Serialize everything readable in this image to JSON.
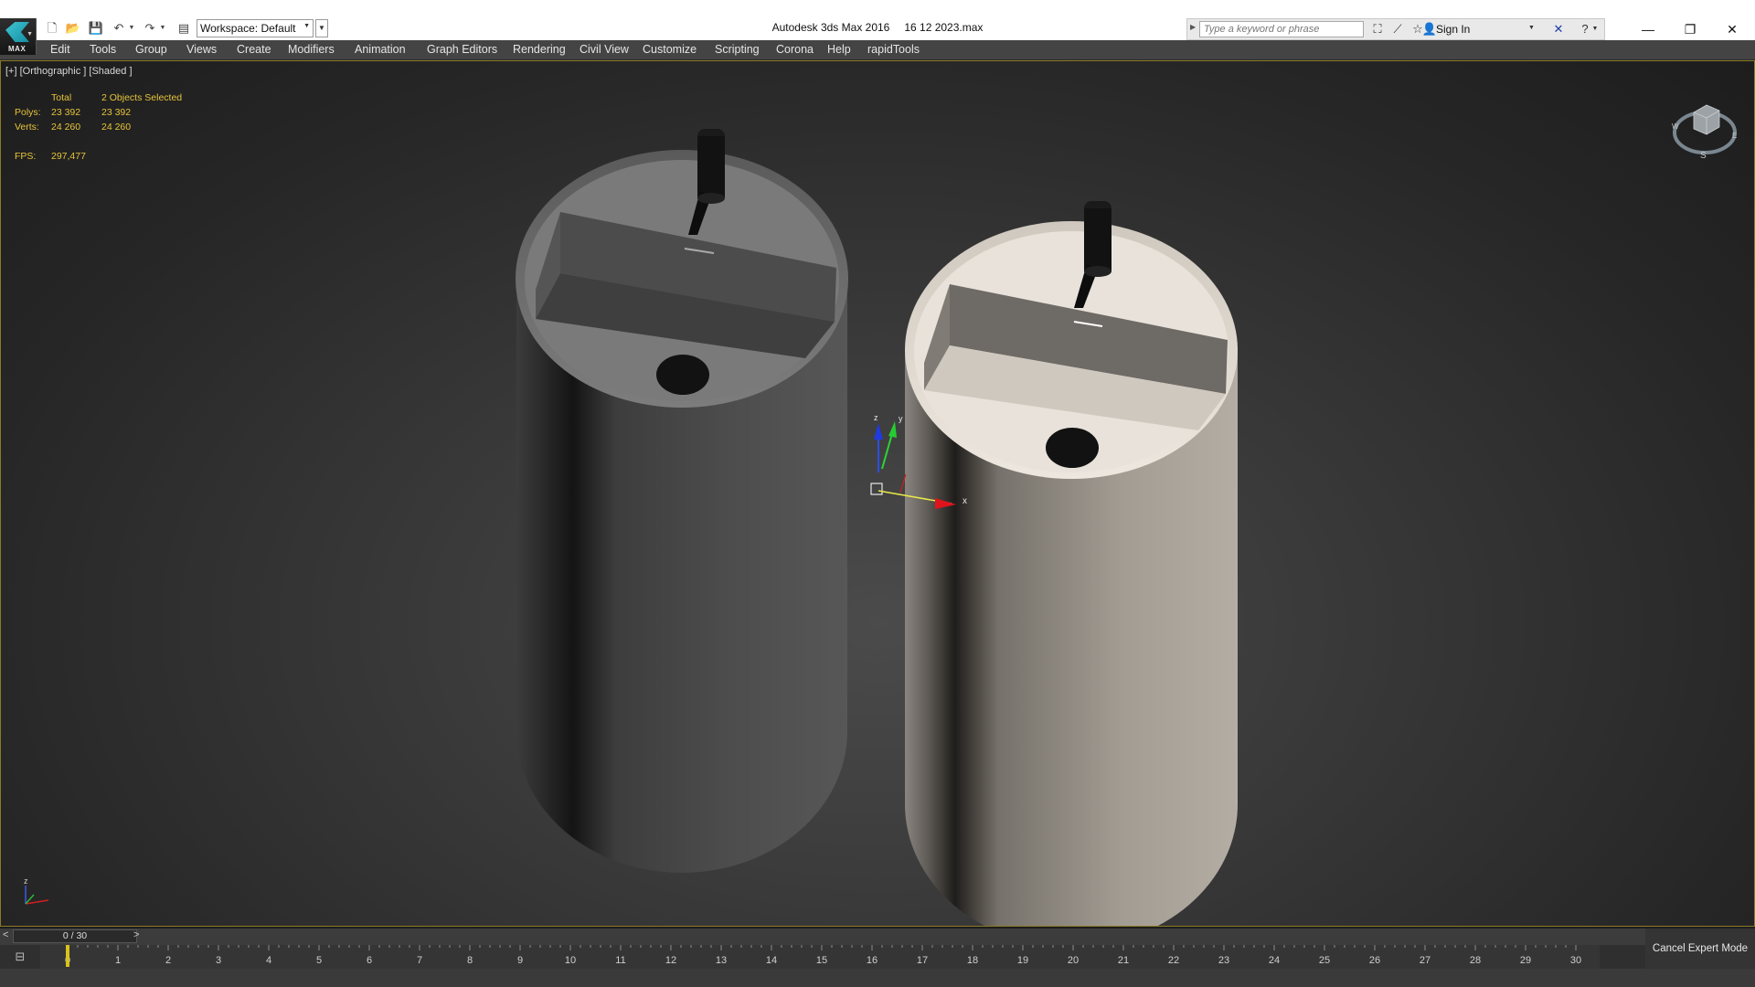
{
  "app": {
    "logo_text": "MAX",
    "title": "Autodesk 3ds Max 2016",
    "file_name": "16 12 2023.max"
  },
  "quick_access": {
    "icons": [
      "new-file-icon",
      "open-file-icon",
      "save-icon",
      "undo-icon",
      "redo-icon",
      "project-folder-icon"
    ],
    "workspace_label": "Workspace: Default"
  },
  "infocenter": {
    "search_placeholder": "Type a keyword or phrase",
    "sign_in_label": "Sign In",
    "icons": [
      "binoculars-icon",
      "communication-center-icon",
      "favorites-star-icon",
      "user-icon",
      "exchange-icon",
      "help-icon"
    ]
  },
  "window_controls": {
    "minimize": "—",
    "restore": "❐",
    "close": "✕"
  },
  "menu": {
    "items": [
      "Edit",
      "Tools",
      "Group",
      "Views",
      "Create",
      "Modifiers",
      "Animation",
      "Graph Editors",
      "Rendering",
      "Civil View",
      "Customize",
      "Scripting",
      "Corona",
      "Help",
      "rapidTools"
    ]
  },
  "viewport": {
    "label": "[+] [Orthographic ] [Shaded ]",
    "stats": {
      "col_total": "Total",
      "col_selected": "2 Objects Selected",
      "polys_label": "Polys:",
      "polys_total": "23 392",
      "polys_selected": "23 392",
      "verts_label": "Verts:",
      "verts_total": "24 260",
      "verts_selected": "24 260",
      "fps_label": "FPS:",
      "fps_value": "297,477"
    },
    "gizmo_labels": {
      "x": "x",
      "y": "y",
      "z": "z"
    },
    "viewcube_labels": {
      "south": "S",
      "west": "W",
      "east": "E"
    },
    "axis_tripod": {
      "z": "z"
    },
    "objects": [
      {
        "name": "sink-dark",
        "color": "#5a5a5a"
      },
      {
        "name": "sink-beige",
        "color": "#d9d2c8"
      }
    ]
  },
  "timeline": {
    "frame_indicator": "0 / 30",
    "prev_label": "<",
    "next_label": ">",
    "ticks": [
      "0",
      "1",
      "2",
      "3",
      "4",
      "5",
      "6",
      "7",
      "8",
      "9",
      "10",
      "11",
      "12",
      "13",
      "14",
      "15",
      "16",
      "17",
      "18",
      "19",
      "20",
      "21",
      "22",
      "23",
      "24",
      "25",
      "26",
      "27",
      "28",
      "29",
      "30"
    ],
    "current_frame": 0,
    "cancel_expert_mode": "Cancel Expert Mode"
  }
}
